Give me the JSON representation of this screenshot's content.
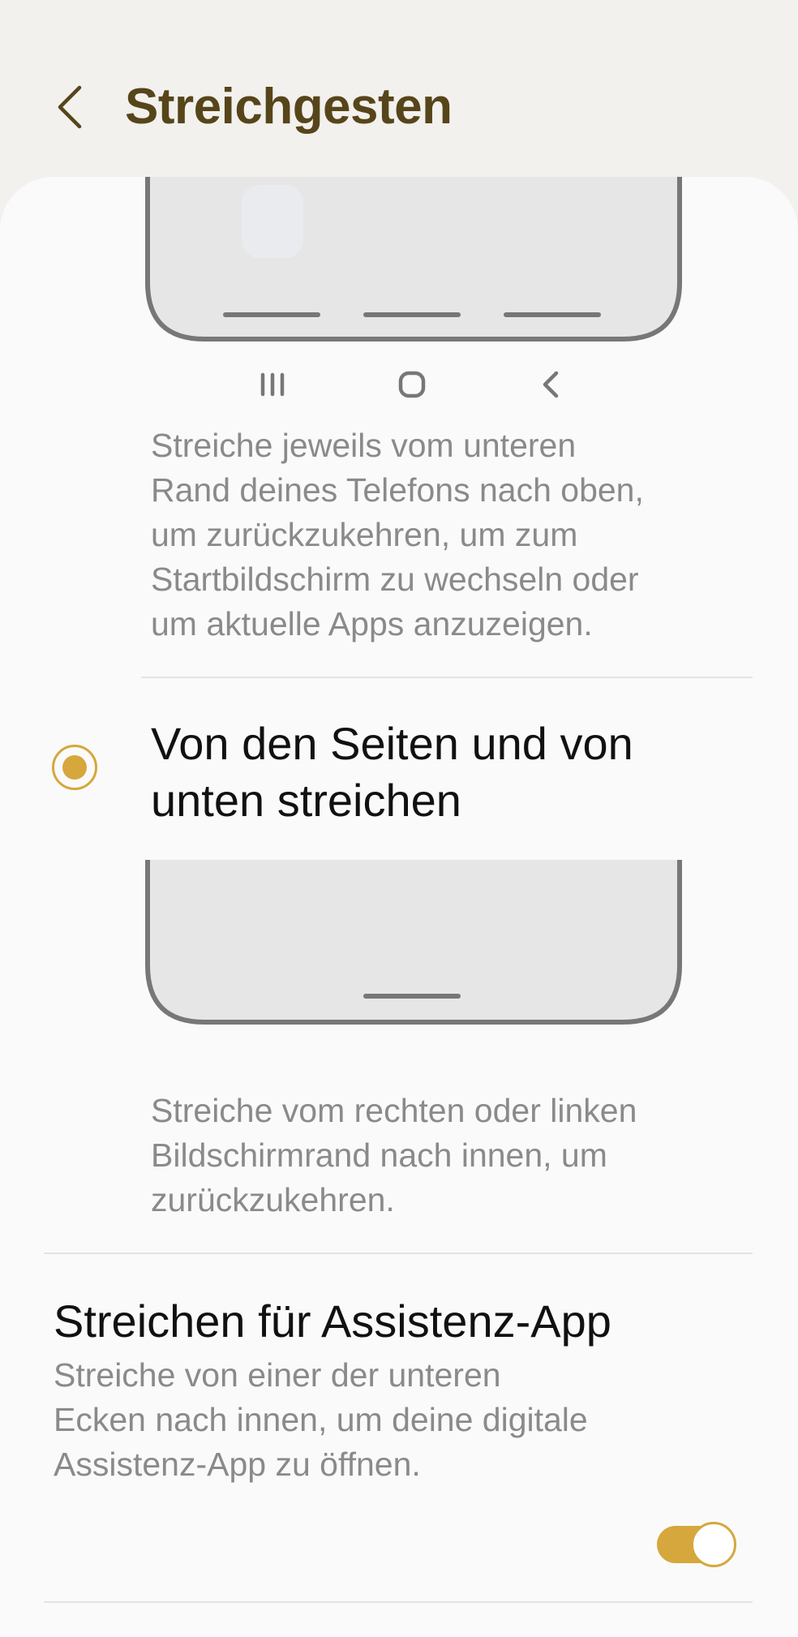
{
  "header": {
    "title": "Streichgesten",
    "back_icon": "chevron-left-icon"
  },
  "navbar_option": {
    "icons": [
      "recent-apps-icon",
      "home-icon",
      "back-icon"
    ],
    "description": [
      "Streiche jeweils vom unteren",
      "Rand deines Telefons nach oben,",
      "um zurückzukehren, um zum",
      "Startbildschirm zu wechseln oder",
      "um aktuelle Apps anzuzeigen."
    ]
  },
  "swipe_option": {
    "title_lines": [
      "Von den Seiten und von",
      "unten streichen"
    ],
    "selected": true,
    "description": [
      "Streiche vom rechten oder linken",
      "Bildschirmrand nach innen, um",
      "zurückzukehren."
    ]
  },
  "assistant_setting": {
    "title": "Streichen für Assistenz-App",
    "description": [
      "Streiche von einer der unteren",
      "Ecken nach innen, um deine digitale",
      "Assistenz-App zu öffnen."
    ],
    "enabled": true
  },
  "colors": {
    "accent": "#d6a73c",
    "title": "#57451a",
    "background": "#f2f1ee",
    "card": "#fafafa",
    "secondary_text": "#8a8a8a"
  }
}
